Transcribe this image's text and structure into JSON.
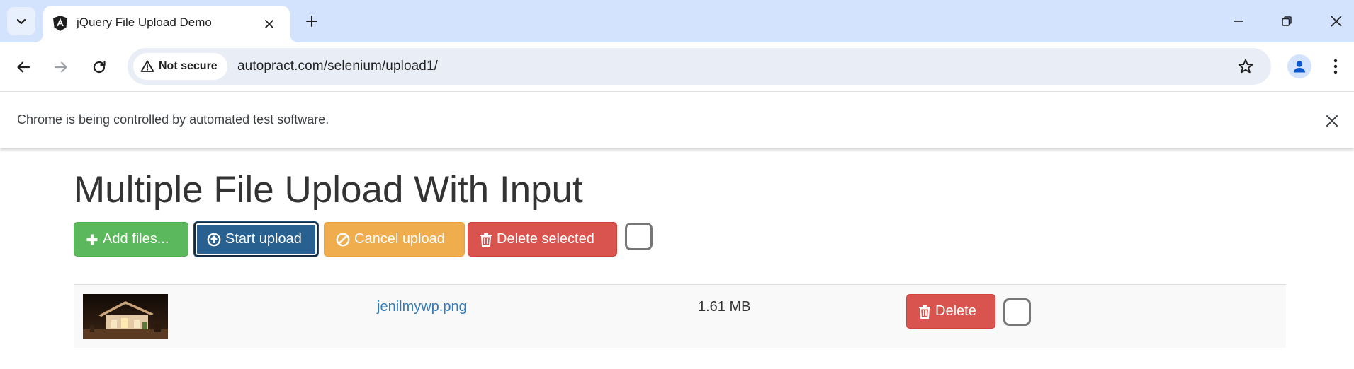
{
  "browser": {
    "tab_title": "jQuery File Upload Demo",
    "security_label": "Not secure",
    "url": "autopract.com/selenium/upload1/",
    "infobar_message": "Chrome is being controlled by automated test software."
  },
  "page": {
    "heading": "Multiple File Upload With Input",
    "buttons": {
      "add_files": "Add files...",
      "start_upload": "Start upload",
      "cancel_upload": "Cancel upload",
      "delete_selected": "Delete selected"
    },
    "files": [
      {
        "name": "jenilmywp.png",
        "size": "1.61 MB",
        "delete_label": "Delete"
      }
    ]
  },
  "colors": {
    "tabstrip_bg": "#d3e3fd",
    "success": "#5cb85c",
    "primary": "#286090",
    "warning": "#f0ad4e",
    "danger": "#d9534f",
    "link": "#337ab7"
  },
  "icons": {
    "tab_search": "chevron-down-icon",
    "favicon": "angular-logo-icon",
    "tab_close": "close-icon",
    "new_tab": "plus-icon",
    "minimize": "minimize-icon",
    "restore": "restore-icon",
    "window_close": "close-icon",
    "back": "arrow-left-icon",
    "forward": "arrow-right-icon",
    "reload": "reload-icon",
    "warning": "warning-triangle-icon",
    "bookmark": "star-icon",
    "profile": "person-icon",
    "menu": "kebab-menu-icon",
    "add": "plus-icon",
    "upload": "circle-arrow-up-icon",
    "cancel": "ban-icon",
    "trash": "trash-icon"
  }
}
